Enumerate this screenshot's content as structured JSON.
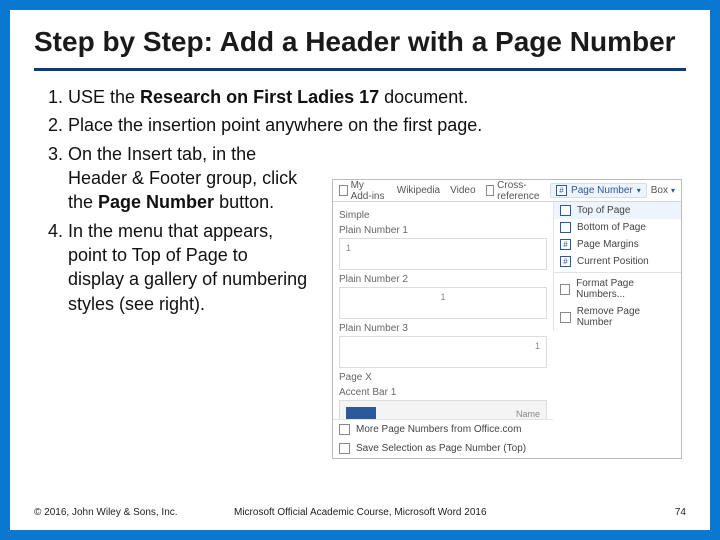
{
  "slide": {
    "title": "Step by Step: Add a Header with a Page Number",
    "steps": {
      "s1_pre": "USE the ",
      "s1_bold": "Research on First Ladies 17",
      "s1_post": " document.",
      "s2": "Place the insertion point anywhere on the first page.",
      "s3_pre": "On the Insert tab, in the Header & Footer group, click the ",
      "s3_bold": "Page Number",
      "s3_post": " button.",
      "s4": "In the menu that appears, point to Top of Page to display a gallery of numbering styles (see right)."
    },
    "footer": {
      "copyright": "© 2016, John Wiley & Sons, Inc.",
      "course": "Microsoft Official Academic Course, Microsoft Word 2016",
      "page": "74"
    }
  },
  "screenshot": {
    "ribbon": {
      "addins": "My Add-ins",
      "wikipedia": "Wikipedia",
      "video": "Video",
      "crossref": "Cross-reference",
      "pagenum": "Page Number",
      "box": "Box"
    },
    "menu": {
      "top": "Top of Page",
      "bottom": "Bottom of Page",
      "margins": "Page Margins",
      "current": "Current Position",
      "format": "Format Page Numbers...",
      "remove": "Remove Page Number"
    },
    "gallery": {
      "simple": "Simple",
      "p1": "Plain Number 1",
      "p2": "Plain Number 2",
      "p3": "Plain Number 3",
      "pagex": "Page X",
      "accent": "Accent Bar 1",
      "more": "More Page Numbers from Office.com",
      "save": "Save Selection as Page Number (Top)"
    }
  }
}
